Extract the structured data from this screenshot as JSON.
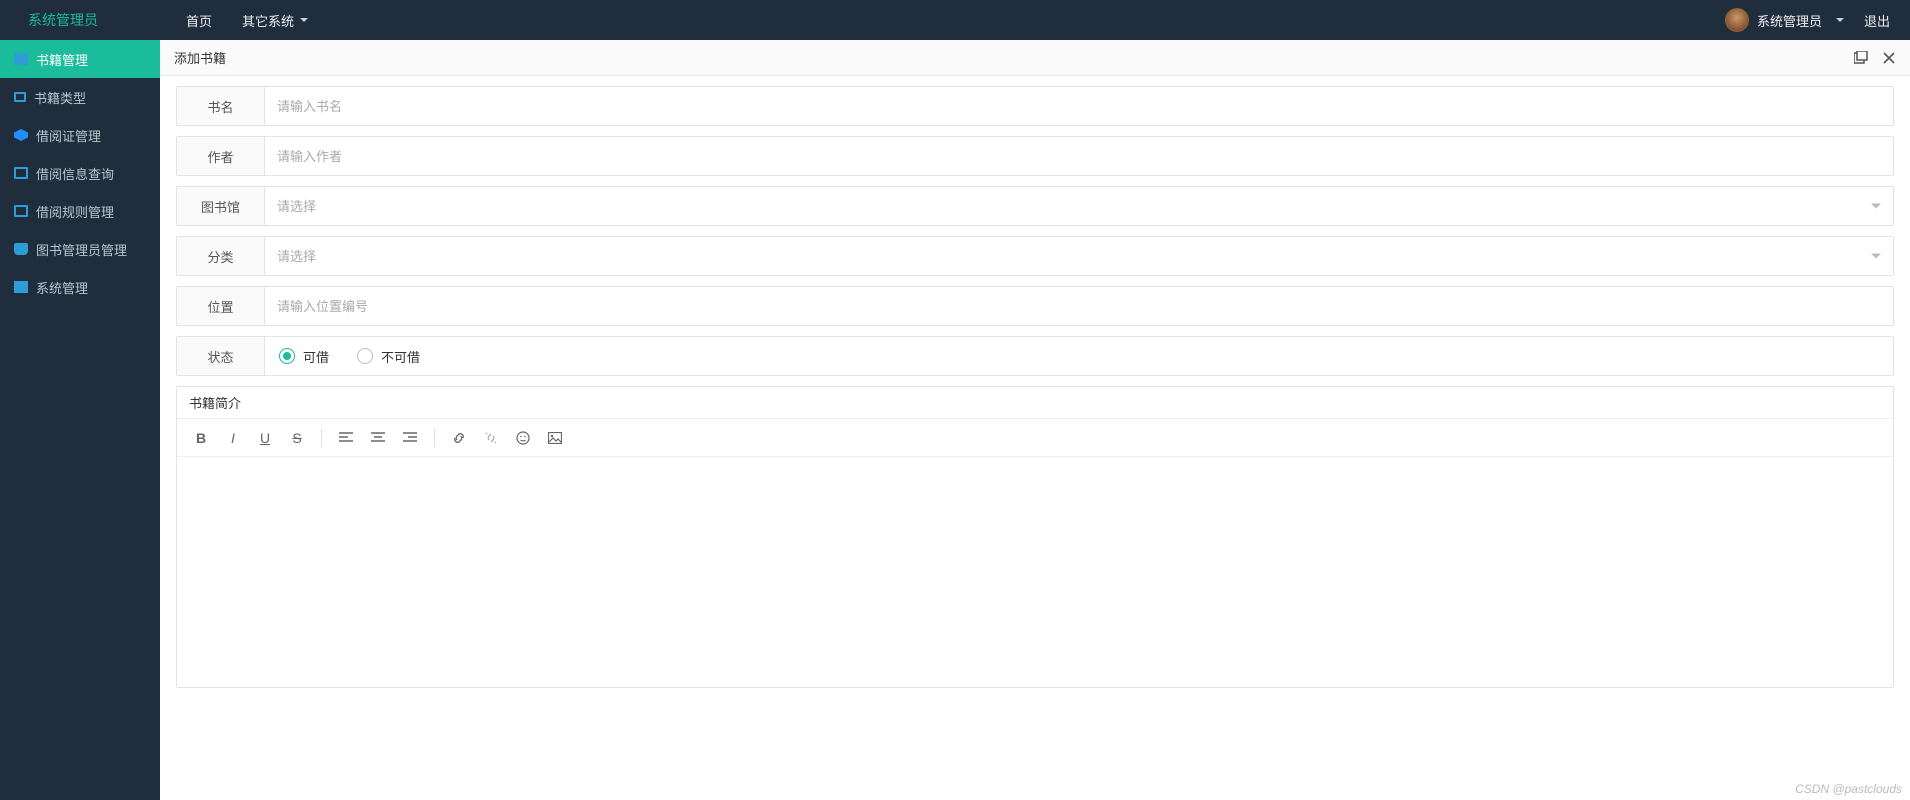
{
  "header": {
    "brand": "系统管理员",
    "nav": {
      "home": "首页",
      "other": "其它系统"
    },
    "user": {
      "name": "系统管理员"
    },
    "logout": "退出"
  },
  "sidebar": {
    "items": [
      {
        "label": "书籍管理"
      },
      {
        "label": "书籍类型"
      },
      {
        "label": "借阅证管理"
      },
      {
        "label": "借阅信息查询"
      },
      {
        "label": "借阅规则管理"
      },
      {
        "label": "图书管理员管理"
      },
      {
        "label": "系统管理"
      }
    ]
  },
  "page": {
    "title": "添加书籍"
  },
  "form": {
    "name": {
      "label": "书名",
      "placeholder": "请输入书名"
    },
    "author": {
      "label": "作者",
      "placeholder": "请输入作者"
    },
    "library": {
      "label": "图书馆",
      "placeholder": "请选择"
    },
    "category": {
      "label": "分类",
      "placeholder": "请选择"
    },
    "position": {
      "label": "位置",
      "placeholder": "请输入位置编号"
    },
    "status": {
      "label": "状态",
      "opt1": "可借",
      "opt2": "不可借"
    }
  },
  "editor": {
    "header": "书籍简介"
  },
  "watermark": "CSDN @pastclouds"
}
